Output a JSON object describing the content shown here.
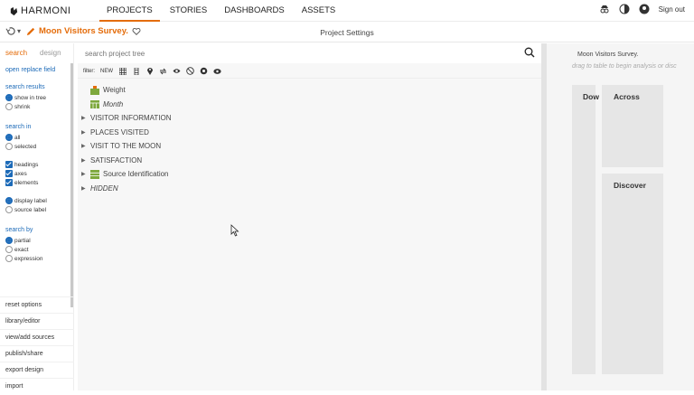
{
  "app": {
    "brand": "HARMONI",
    "sign_out": "Sign out"
  },
  "nav": [
    {
      "label": "PROJECTS",
      "active": true
    },
    {
      "label": "STORIES",
      "active": false
    },
    {
      "label": "DASHBOARDS",
      "active": false
    },
    {
      "label": "ASSETS",
      "active": false
    }
  ],
  "subbar": {
    "project_name": "Moon Visitors Survey.",
    "title": "Project Settings"
  },
  "left": {
    "tabs": {
      "search": "search",
      "design": "design"
    },
    "open_replace": "open replace field",
    "search_results": {
      "heading": "search results",
      "options": [
        "show in tree",
        "shrink"
      ]
    },
    "search_in": {
      "heading": "search in",
      "options": [
        "all",
        "selected"
      ]
    },
    "checks": [
      "headings",
      "axes",
      "elements"
    ],
    "label_opts": [
      "display label",
      "source label"
    ],
    "search_by": {
      "heading": "search by",
      "options": [
        "partial",
        "exact",
        "expression"
      ]
    },
    "bottom": [
      "reset options",
      "library/editor",
      "view/add sources",
      "publish/share",
      "export design",
      "import"
    ]
  },
  "center": {
    "search_placeholder": "search project tree",
    "filter_label": "filter:",
    "filter_new": "NEW",
    "tree": {
      "weight": "Weight",
      "month": "Month",
      "visitor": "VISITOR INFORMATION",
      "places": "PLACES VISITED",
      "visit": "VISIT TO THE MOON",
      "satisfaction": "SATISFACTION",
      "source": "Source Identification",
      "hidden": "HIDDEN"
    }
  },
  "right": {
    "title": "Moon Visitors Survey.",
    "hint": "drag to table to begin analysis or disc",
    "down": "Dow",
    "across": "Across",
    "discover": "Discover"
  },
  "colors": {
    "accent": "#e46c0a",
    "link": "#1c6ab8"
  }
}
